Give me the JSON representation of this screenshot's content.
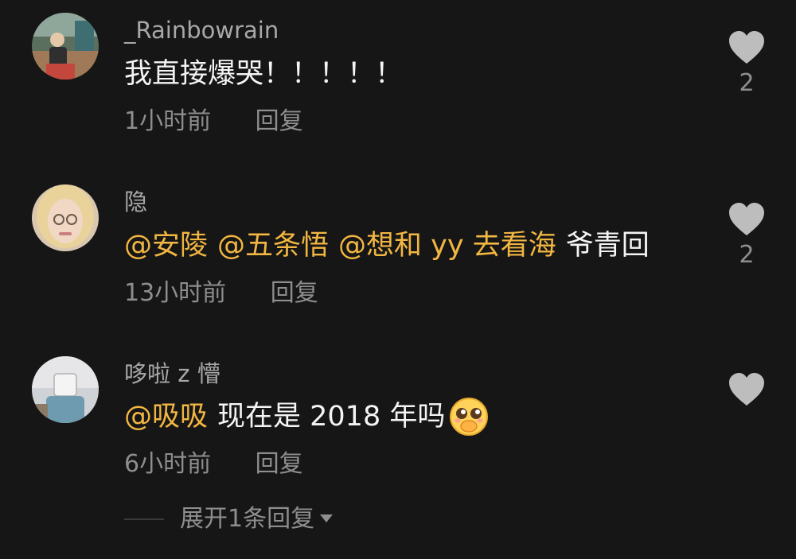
{
  "comments": [
    {
      "username": "_Rainbowrain",
      "text": "我直接爆哭！！！！！",
      "time": "1小时前",
      "reply_label": "回复",
      "like_count": "2",
      "avatar_icon": "user-photo-avatar"
    },
    {
      "username": "隐",
      "mentions": [
        "@安陵",
        "@五条悟",
        "@想和 yy 去看海"
      ],
      "text": "爷青回",
      "time": "13小时前",
      "reply_label": "回复",
      "like_count": "2",
      "avatar_icon": "user-photo-avatar"
    },
    {
      "username": "哆啦 z 懵",
      "mentions": [
        "@吸吸"
      ],
      "text": "现在是 2018 年吗",
      "emoji": "pleading-face-emoji",
      "time": "6小时前",
      "reply_label": "回复",
      "like_count": "",
      "avatar_icon": "user-photo-avatar"
    }
  ],
  "expand_replies_label": "展开1条回复",
  "colors": {
    "background": "#161616",
    "mention": "#f2b642",
    "secondary_text": "#8e8e8e",
    "heart": "#bdbdbd"
  },
  "icons": {
    "like": "heart-icon",
    "expand": "caret-down-icon"
  }
}
